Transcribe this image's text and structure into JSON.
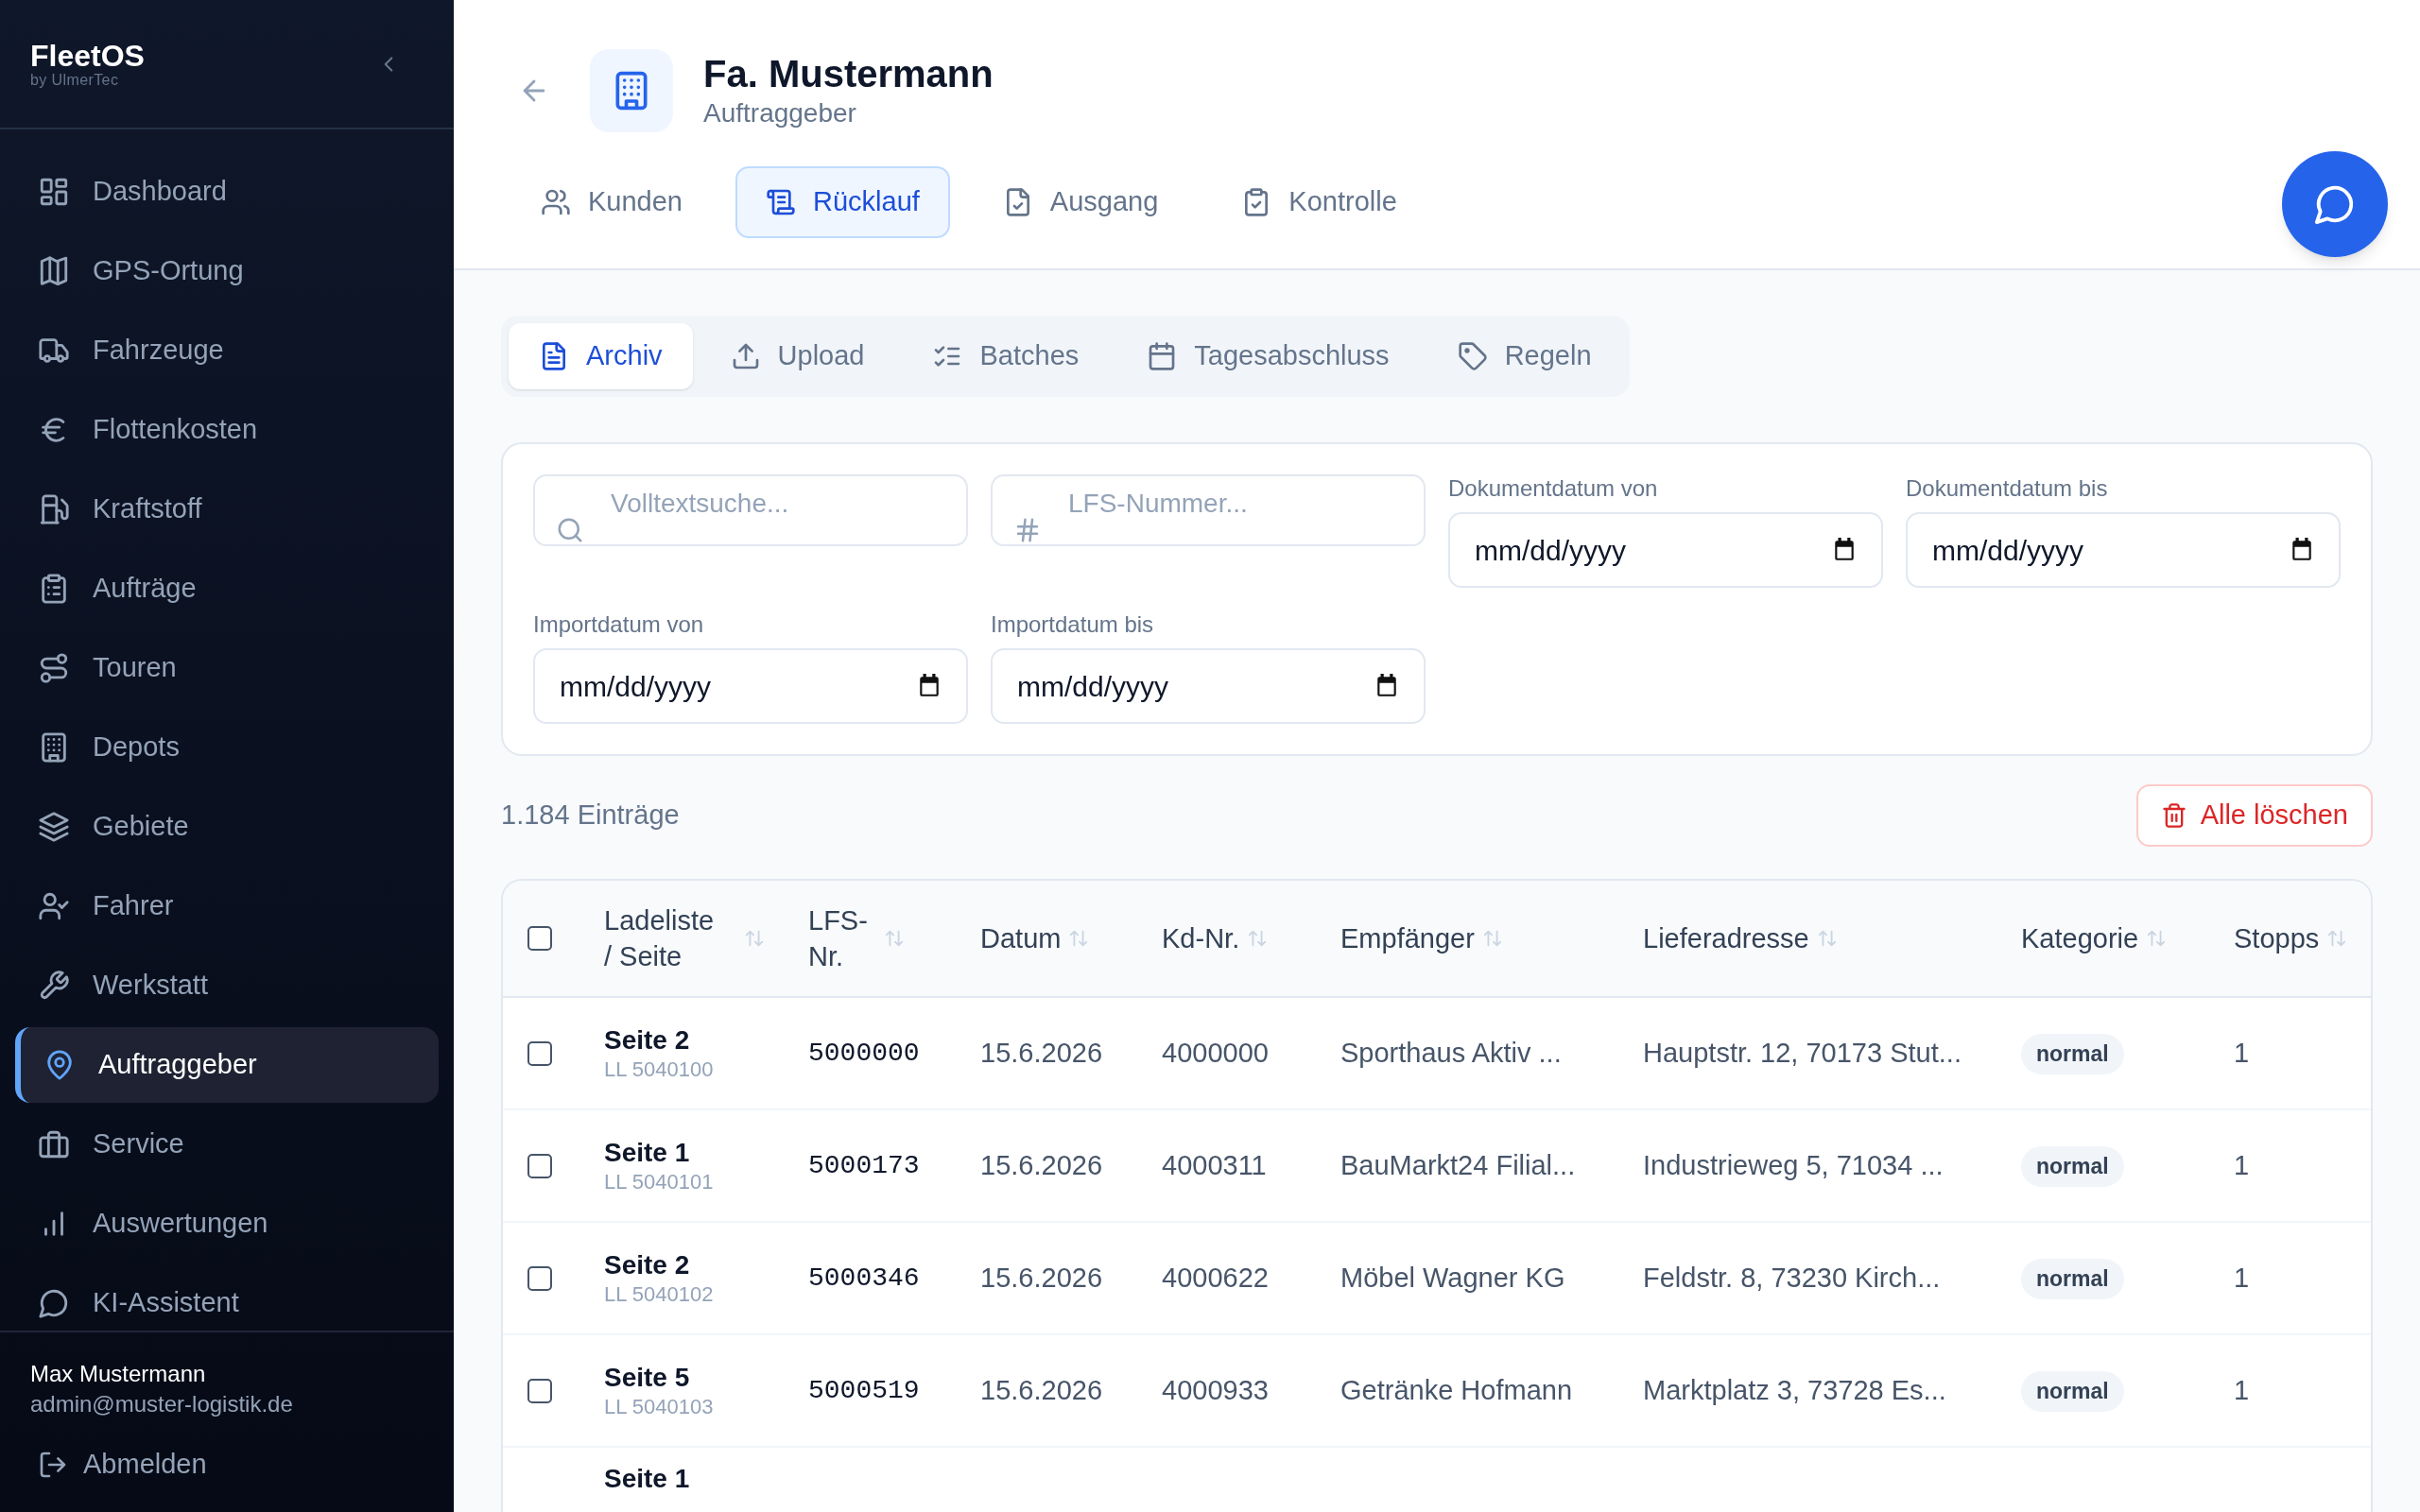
{
  "brand": {
    "name": "FleetOS",
    "tagline": "by UlmerTec"
  },
  "sidebar": {
    "items": [
      {
        "label": "Dashboard",
        "selected": false
      },
      {
        "label": "GPS-Ortung",
        "selected": false
      },
      {
        "label": "Fahrzeuge",
        "selected": false
      },
      {
        "label": "Flottenkosten",
        "selected": false
      },
      {
        "label": "Kraftstoff",
        "selected": false
      },
      {
        "label": "Aufträge",
        "selected": false
      },
      {
        "label": "Touren",
        "selected": false
      },
      {
        "label": "Depots",
        "selected": false
      },
      {
        "label": "Gebiete",
        "selected": false
      },
      {
        "label": "Fahrer",
        "selected": false
      },
      {
        "label": "Werkstatt",
        "selected": false
      },
      {
        "label": "Auftraggeber",
        "selected": true
      },
      {
        "label": "Service",
        "selected": false
      },
      {
        "label": "Auswertungen",
        "selected": false
      },
      {
        "label": "KI-Assistent",
        "selected": false
      }
    ],
    "user": {
      "name": "Max Mustermann",
      "email": "admin@muster-logistik.de"
    },
    "logout": "Abmelden"
  },
  "header": {
    "title": "Fa. Mustermann",
    "subtitle": "Auftraggeber"
  },
  "tabs": [
    {
      "label": "Kunden",
      "selected": false
    },
    {
      "label": "Rücklauf",
      "selected": true
    },
    {
      "label": "Ausgang",
      "selected": false
    },
    {
      "label": "Kontrolle",
      "selected": false
    }
  ],
  "subtabs": [
    {
      "label": "Archiv",
      "selected": true
    },
    {
      "label": "Upload",
      "selected": false
    },
    {
      "label": "Batches",
      "selected": false
    },
    {
      "label": "Tagesabschluss",
      "selected": false
    },
    {
      "label": "Regeln",
      "selected": false
    }
  ],
  "filters": [
    {
      "kind": "search",
      "placeholder": "Volltextsuche..."
    },
    {
      "kind": "number",
      "placeholder": "LFS-Nummer..."
    },
    {
      "kind": "date",
      "label": "Dokumentdatum von",
      "placeholder": "mm/dd/yyyy"
    },
    {
      "kind": "date",
      "label": "Dokumentdatum bis",
      "placeholder": "mm/dd/yyyy"
    },
    {
      "kind": "date",
      "label": "Importdatum von",
      "placeholder": "mm/dd/yyyy"
    },
    {
      "kind": "date",
      "label": "Importdatum bis",
      "placeholder": "mm/dd/yyyy"
    }
  ],
  "count": "1.184 Einträge",
  "delete_all": "Alle löschen",
  "table": {
    "select_all_checked": false,
    "columns": [
      "Ladeliste / Seite",
      "LFS-Nr.",
      "Datum",
      "Kd-Nr.",
      "Empfänger",
      "Lieferadresse",
      "Kategorie",
      "Stopps"
    ],
    "rows": [
      {
        "checked": false,
        "page": "Seite 2",
        "list": "LL 5040100",
        "lfs": "5000000",
        "date": "15.6.2026",
        "customer_no": "4000000",
        "recipient": "Sporthaus Aktiv ...",
        "address": "Hauptstr. 12, 70173 Stut...",
        "category": "normal",
        "stops": "1"
      },
      {
        "checked": false,
        "page": "Seite 1",
        "list": "LL 5040101",
        "lfs": "5000173",
        "date": "15.6.2026",
        "customer_no": "4000311",
        "recipient": "BauMarkt24 Filial...",
        "address": "Industrieweg 5, 71034 ...",
        "category": "normal",
        "stops": "1"
      },
      {
        "checked": false,
        "page": "Seite 2",
        "list": "LL 5040102",
        "lfs": "5000346",
        "date": "15.6.2026",
        "customer_no": "4000622",
        "recipient": "Möbel Wagner KG",
        "address": "Feldstr. 8, 73230 Kirch...",
        "category": "normal",
        "stops": "1"
      },
      {
        "checked": false,
        "page": "Seite 5",
        "list": "LL 5040103",
        "lfs": "5000519",
        "date": "15.6.2026",
        "customer_no": "4000933",
        "recipient": "Getränke Hofmann",
        "address": "Marktplatz 3, 73728 Es...",
        "category": "normal",
        "stops": "1"
      },
      {
        "kind": "partial",
        "page": "Seite 1"
      }
    ]
  }
}
